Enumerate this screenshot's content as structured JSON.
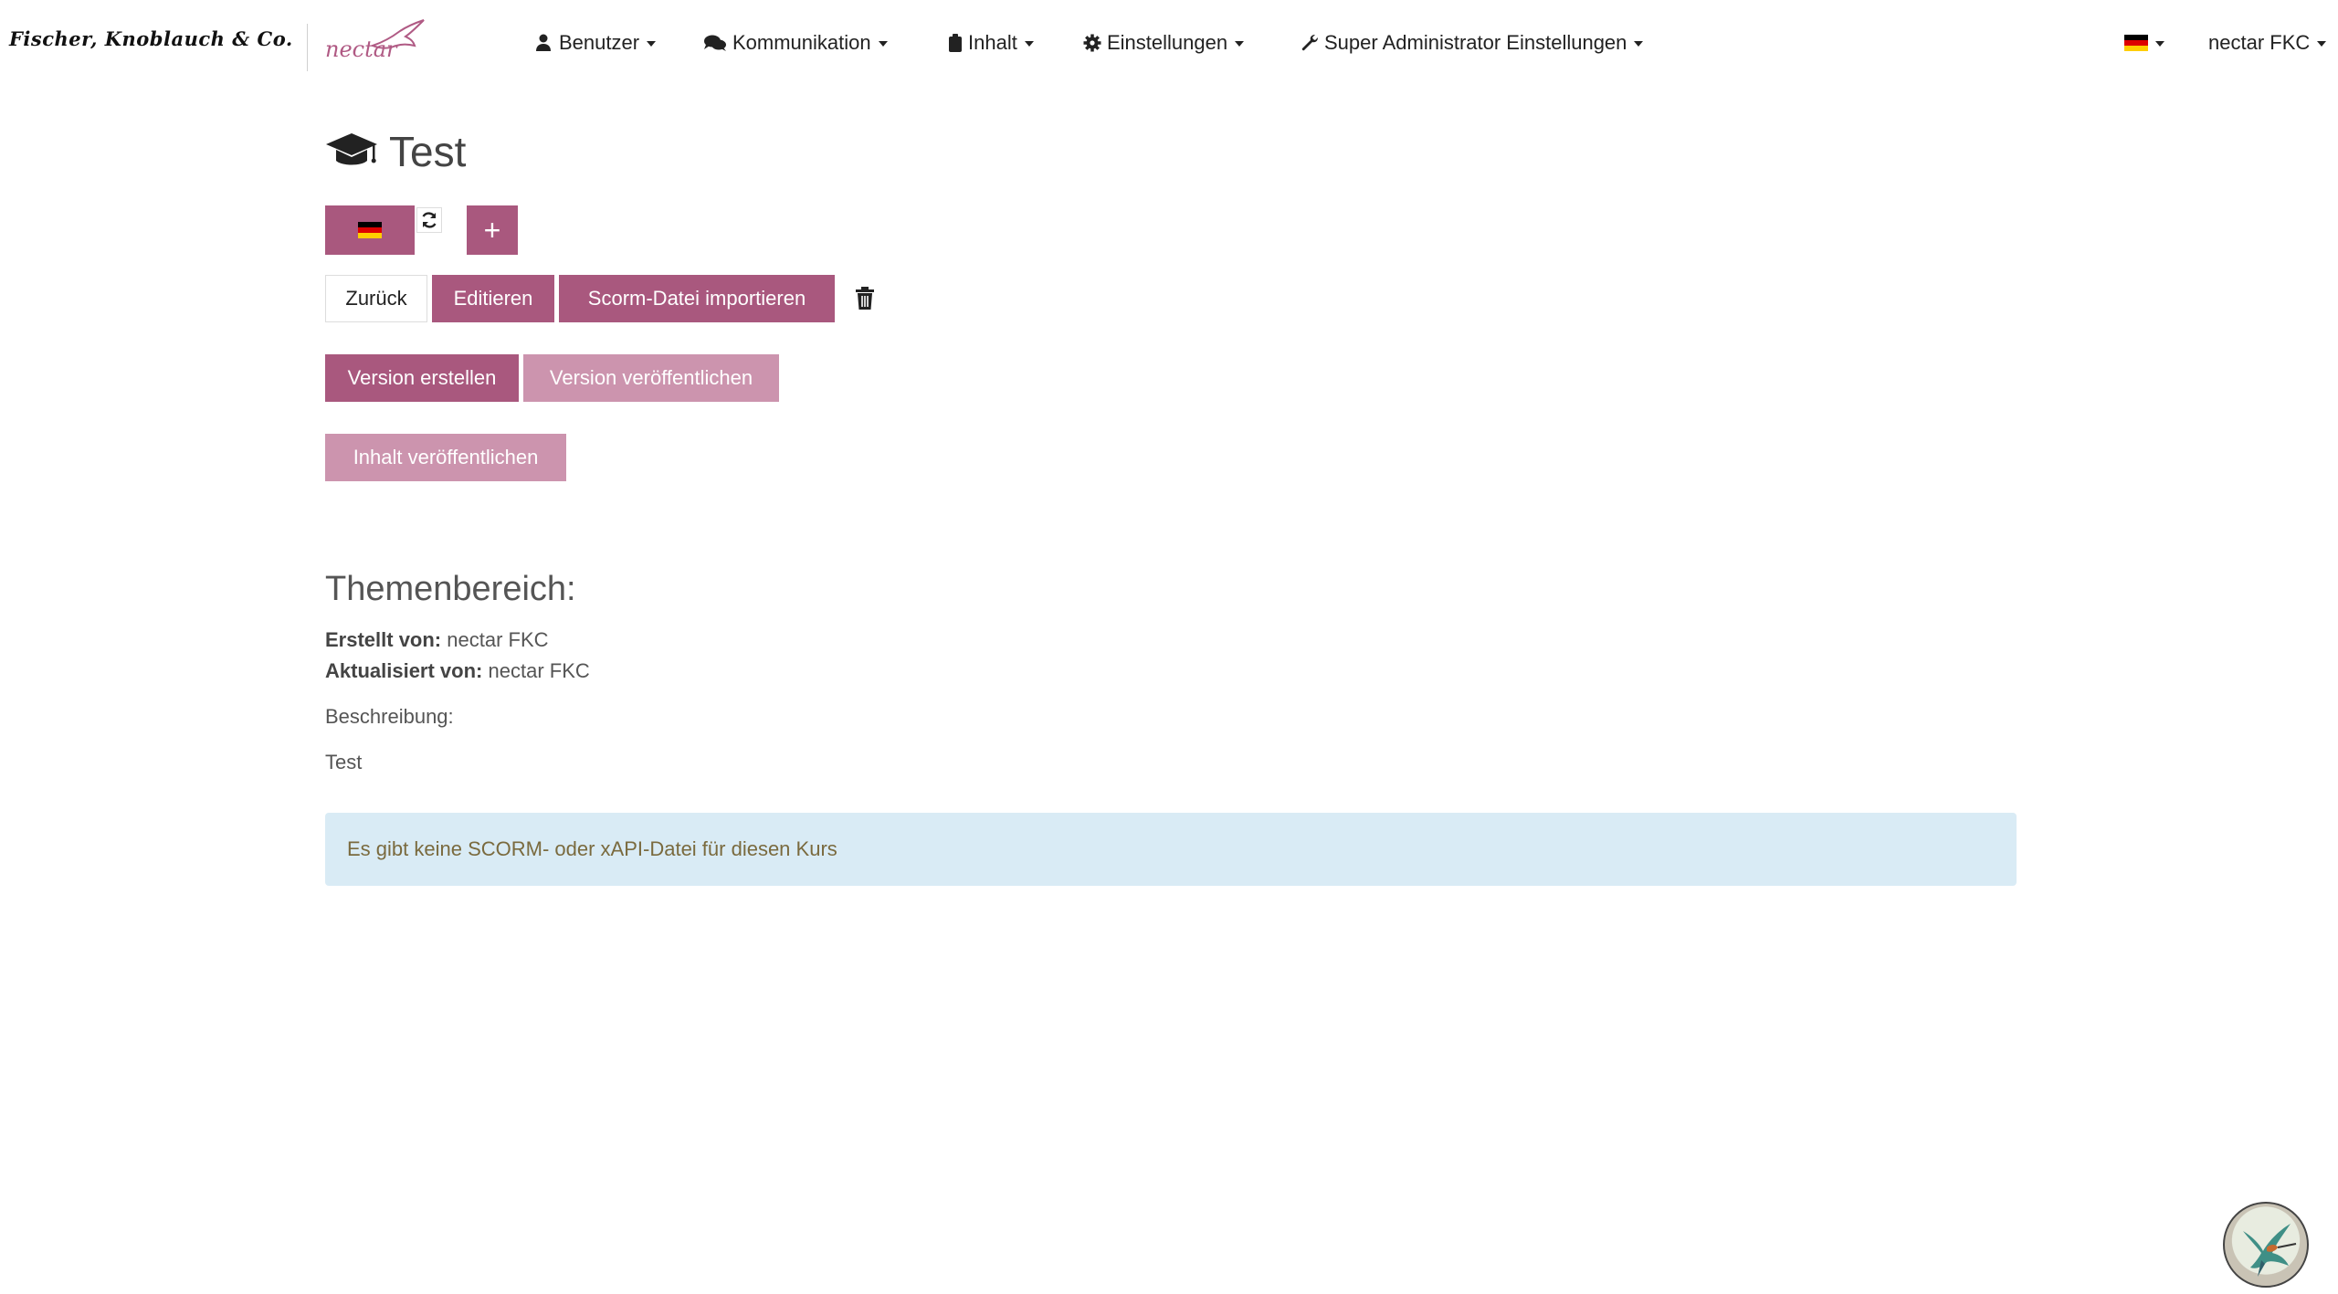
{
  "navbar": {
    "brand": "Fischer, Knoblauch & Co.",
    "logo_text": "nectar",
    "items": [
      {
        "label": "Benutzer"
      },
      {
        "label": "Kommunikation"
      },
      {
        "label": "Inhalt"
      },
      {
        "label": "Einstellungen"
      },
      {
        "label": "Super Administrator Einstellungen"
      }
    ],
    "user": "nectar FKC"
  },
  "page": {
    "title": "Test"
  },
  "buttons": {
    "plus": "+",
    "back": "Zurück",
    "edit": "Editieren",
    "import_scorm": "Scorm-Datei importieren",
    "create_version": "Version erstellen",
    "publish_version": "Version veröffentlichen",
    "publish_content": "Inhalt veröffentlichen"
  },
  "details": {
    "section_title": "Themenbereich:",
    "created_by_label": "Erstellt von:",
    "created_by": "nectar FKC",
    "updated_by_label": "Aktualisiert von:",
    "updated_by": "nectar FKC",
    "description_label": "Beschreibung:",
    "description": "Test"
  },
  "alert": {
    "text": "Es gibt keine SCORM- oder xAPI-Datei für diesen Kurs"
  },
  "colors": {
    "primary": "#a9587e",
    "primary_light": "#cc94ae",
    "alert_bg": "#d9ebf5"
  }
}
